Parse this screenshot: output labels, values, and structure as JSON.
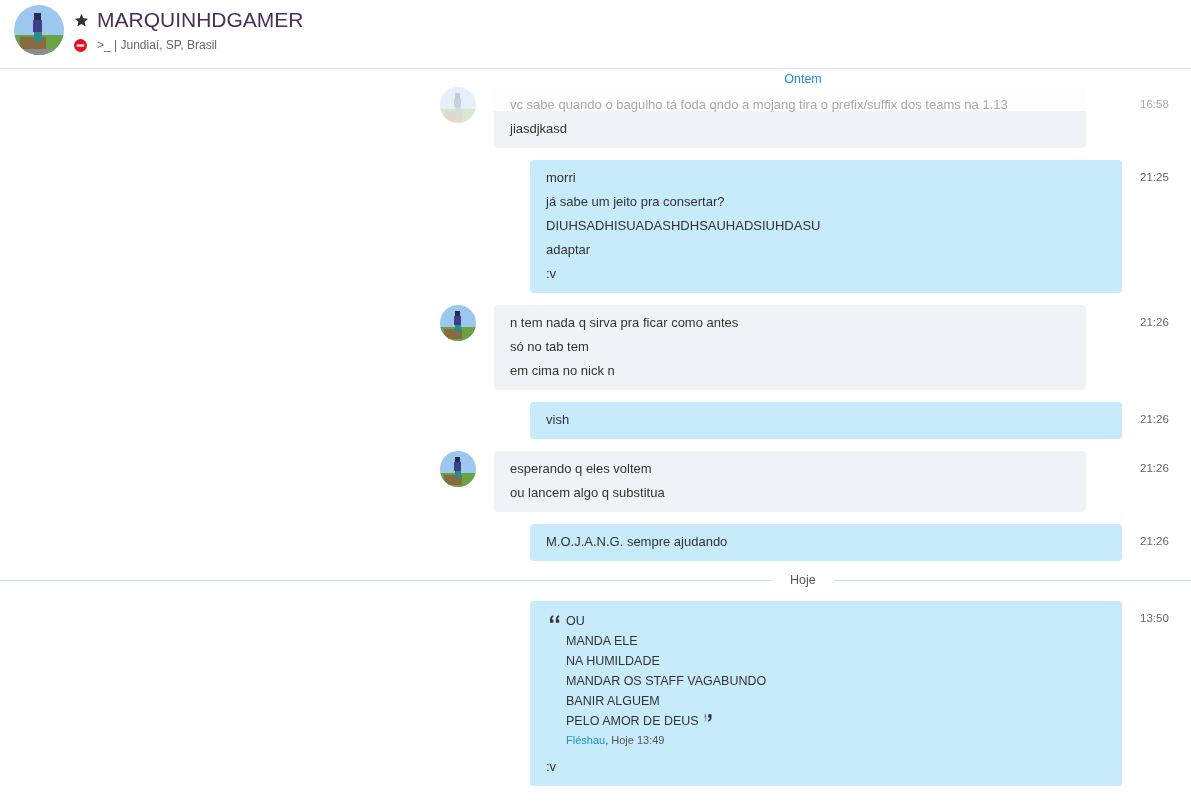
{
  "contact": {
    "name": "MARQUINHDGAMER",
    "favorite": true,
    "busy": true,
    "mood": ">_ | Jundiaí, SP, Brasil"
  },
  "sticky_date": "Ontem",
  "items": [
    {
      "kind": "incoming",
      "faded": true,
      "lines": [
        "vc sabe quando o bagulho tá foda qndo a mojang tira o prefix/suffix dos teams na 1.13",
        "jiasdjkasd"
      ],
      "time": "16:58"
    },
    {
      "kind": "outgoing",
      "faded": false,
      "lines": [
        "morri",
        "já sabe um jeito pra consertar?",
        "DIUHSADHISUADASHDHSAUHADSIUHDASU",
        "adaptar",
        ":v"
      ],
      "time": "21:25"
    },
    {
      "kind": "incoming",
      "faded": false,
      "lines": [
        "n tem nada q sirva pra ficar como antes",
        "só no tab tem",
        "em cima no nick n"
      ],
      "time": "21:26"
    },
    {
      "kind": "outgoing",
      "faded": false,
      "lines": [
        "vish"
      ],
      "time": "21:26"
    },
    {
      "kind": "incoming",
      "faded": false,
      "lines": [
        "esperando q eles voltem",
        "ou lancem algo q substitua"
      ],
      "time": "21:26"
    },
    {
      "kind": "outgoing",
      "faded": false,
      "lines": [
        "M.O.J.A.N.G. sempre ajudando"
      ],
      "time": "21:26"
    },
    {
      "kind": "date",
      "label": "Hoje"
    },
    {
      "kind": "outgoing",
      "faded": false,
      "quote": {
        "lines": [
          "OU",
          "MANDA ELE",
          "NA HUMILDADE",
          "MANDAR OS STAFF VAGABUNDO",
          "BANIR ALGUEM",
          "PELO AMOR DE DEUS"
        ],
        "author": "Fléshau",
        "meta": ", Hoje 13:49"
      },
      "lines": [
        ":v"
      ],
      "time": "13:50"
    }
  ]
}
